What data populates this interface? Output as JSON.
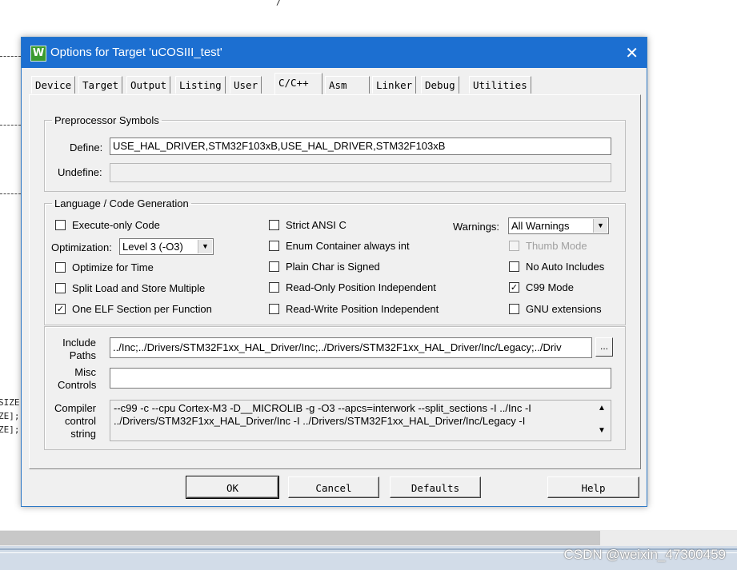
{
  "background": {
    "code_lines": [
      "SIZE",
      "ZE];",
      "ZE];"
    ],
    "top_fragment": "/",
    "watermark": "CSDN @weixin_47300459"
  },
  "dialog": {
    "title": "Options for Target 'uCOSIII_test'",
    "app_icon": "W",
    "close_glyph": "✕",
    "tabs": [
      "Device",
      "Target",
      "Output",
      "Listing",
      "User",
      "C/C++",
      "Asm",
      "Linker",
      "Debug",
      "Utilities"
    ],
    "active_tab": "C/C++",
    "preprocessor": {
      "legend": "Preprocessor Symbols",
      "define_label": "Define:",
      "define_value": "USE_HAL_DRIVER,STM32F103xB,USE_HAL_DRIVER,STM32F103xB",
      "undefine_label": "Undefine:",
      "undefine_value": ""
    },
    "language": {
      "legend": "Language / Code Generation",
      "execute_only": {
        "label": "Execute-only Code",
        "checked": false
      },
      "optimization_label": "Optimization:",
      "optimization_value": "Level 3 (-O3)",
      "optimize_time": {
        "label": "Optimize for Time",
        "checked": false
      },
      "split_load": {
        "label": "Split Load and Store Multiple",
        "checked": false
      },
      "one_elf": {
        "label": "One ELF Section per Function",
        "checked": true
      },
      "strict_ansi": {
        "label": "Strict ANSI C",
        "checked": false
      },
      "enum_container": {
        "label": "Enum Container always int",
        "checked": false
      },
      "plain_char": {
        "label": "Plain Char is Signed",
        "checked": false
      },
      "ro_pi": {
        "label": "Read-Only Position Independent",
        "checked": false
      },
      "rw_pi": {
        "label": "Read-Write Position Independent",
        "checked": false
      },
      "warnings_label": "Warnings:",
      "warnings_value": "All Warnings",
      "thumb_mode": {
        "label": "Thumb Mode",
        "checked": false
      },
      "no_auto_includes": {
        "label": "No Auto Includes",
        "checked": false
      },
      "c99_mode": {
        "label": "C99 Mode",
        "checked": true
      },
      "gnu_ext": {
        "label": "GNU extensions",
        "checked": false
      },
      "check_glyph": "✓"
    },
    "include": {
      "label": "Include Paths",
      "value": "../Inc;../Drivers/STM32F1xx_HAL_Driver/Inc;../Drivers/STM32F1xx_HAL_Driver/Inc/Legacy;../Driv",
      "browse": "..."
    },
    "misc": {
      "label": "Misc Controls",
      "value": ""
    },
    "compiler": {
      "label": "Compiler control string",
      "line1": "--c99 -c --cpu Cortex-M3 -D__MICROLIB -g -O3 --apcs=interwork --split_sections -I ../Inc -I",
      "line2": "../Drivers/STM32F1xx_HAL_Driver/Inc -I ../Drivers/STM32F1xx_HAL_Driver/Inc/Legacy -I",
      "scroll_up": "▲",
      "scroll_down": "▼"
    },
    "buttons": {
      "ok": "OK",
      "cancel": "Cancel",
      "defaults": "Defaults",
      "help": "Help"
    },
    "dropdown_glyph": "▼"
  }
}
